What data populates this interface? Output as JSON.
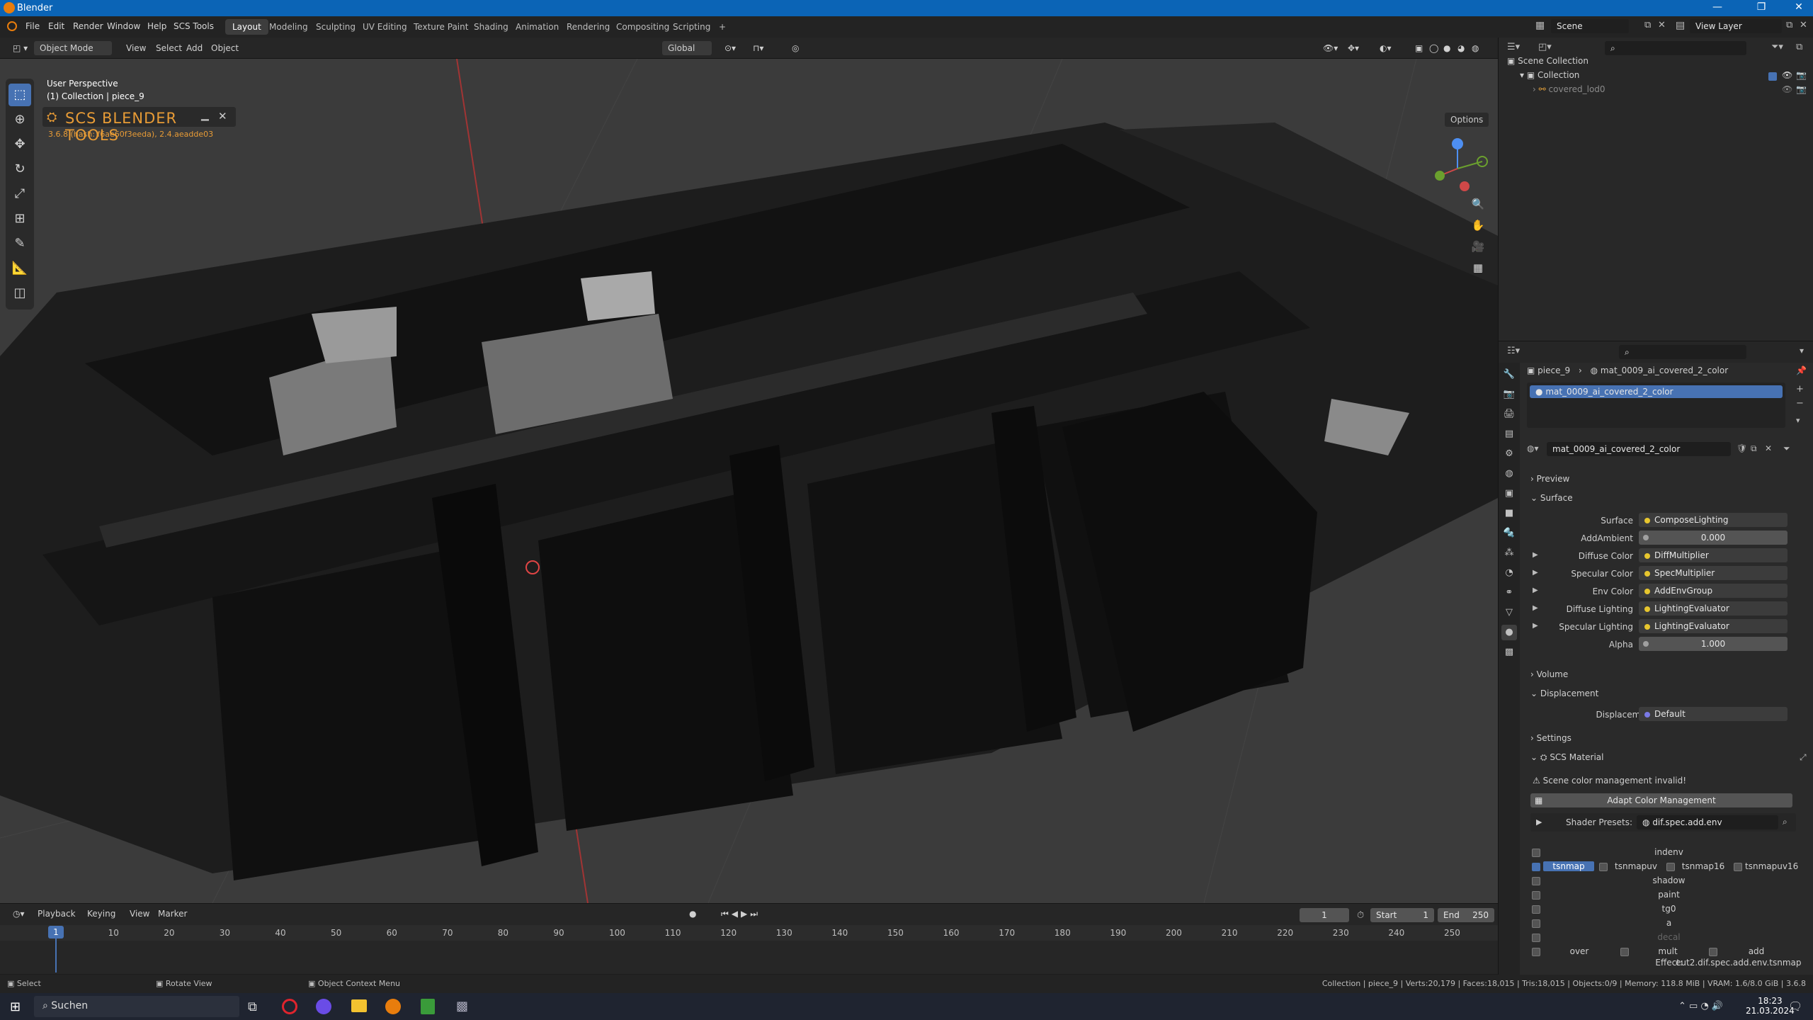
{
  "app": {
    "title": "Blender",
    "logo_color": "#e87d0d"
  },
  "menu": [
    "File",
    "Edit",
    "Render",
    "Window",
    "Help",
    "SCS Tools"
  ],
  "workspaces": [
    "Layout",
    "Modeling",
    "Sculpting",
    "UV Editing",
    "Texture Paint",
    "Shading",
    "Animation",
    "Rendering",
    "Compositing",
    "Scripting"
  ],
  "active_workspace": "Layout",
  "scene": {
    "name": "Scene",
    "view_layer": "View Layer"
  },
  "viewport": {
    "mode": "Object Mode",
    "menus": [
      "View",
      "Select",
      "Add",
      "Object"
    ],
    "transform_orientation": "Global",
    "options_label": "Options",
    "perspective_label": "User Perspective",
    "collection_label": "(1) Collection | piece_9",
    "scs_title": "SCS BLENDER TOOLS",
    "scs_version": "3.6.8 (hash: f6ae60f3eeda), 2.4.aeadde03"
  },
  "outliner": {
    "items": [
      {
        "label": "Scene Collection",
        "level": 0
      },
      {
        "label": "Collection",
        "level": 1
      },
      {
        "label": "covered_lod0",
        "level": 2
      }
    ]
  },
  "properties": {
    "breadcrumb": [
      "piece_9",
      "mat_0009_ai_covered_2_color"
    ],
    "slot": "mat_0009_ai_covered_2_color",
    "material_name": "mat_0009_ai_covered_2_color",
    "sections": {
      "preview": "Preview",
      "surface": "Surface",
      "volume": "Volume",
      "displacement": "Displacement",
      "settings": "Settings",
      "scs_material": "SCS Material"
    },
    "surface_rows": [
      {
        "label": "Surface",
        "value": "ComposeLighting",
        "kind": "socket"
      },
      {
        "label": "AddAmbient",
        "value": "0.000",
        "kind": "number"
      },
      {
        "label": "Diffuse Color",
        "value": "DiffMultiplier",
        "kind": "socket"
      },
      {
        "label": "Specular Color",
        "value": "SpecMultiplier",
        "kind": "socket"
      },
      {
        "label": "Env Color",
        "value": "AddEnvGroup",
        "kind": "socket"
      },
      {
        "label": "Diffuse Lighting",
        "value": "LightingEvaluator",
        "kind": "socket"
      },
      {
        "label": "Specular Lighting",
        "value": "LightingEvaluator",
        "kind": "socket"
      },
      {
        "label": "Alpha",
        "value": "1.000",
        "kind": "number"
      }
    ],
    "displacement_row": {
      "label": "Displacement",
      "value": "Default"
    },
    "scs": {
      "warning": "Scene color management invalid!",
      "adapt_button": "Adapt Color Management",
      "shader_presets_label": "Shader Presets:",
      "shader_preset_value": "dif.spec.add.env",
      "flags": [
        "indenv",
        "tsnmap",
        "tsnmapuv",
        "tsnmap16",
        "tsnmapuv16",
        "shadow",
        "paint",
        "tg0",
        "a",
        "decal",
        "over",
        "mult",
        "add"
      ],
      "effect_label": "Effect:",
      "effect_value": "eut2.dif.spec.add.env.tsnmap"
    }
  },
  "timeline": {
    "menus": [
      "Playback",
      "Keying",
      "View",
      "Marker"
    ],
    "current_frame": "1",
    "start_label": "Start",
    "start": "1",
    "end_label": "End",
    "end": "250",
    "ticks": [
      "10",
      "20",
      "30",
      "40",
      "50",
      "60",
      "70",
      "80",
      "90",
      "100",
      "110",
      "120",
      "130",
      "140",
      "150",
      "160",
      "170",
      "180",
      "190",
      "200",
      "210",
      "220",
      "230",
      "240",
      "250"
    ]
  },
  "statusbar": {
    "left": [
      "Select",
      "Rotate View",
      "Object Context Menu"
    ],
    "right": "Collection | piece_9 | Verts:20,179 | Faces:18,015 | Tris:18,015 | Objects:0/9 | Memory: 118.8 MiB | VRAM: 1.6/8.0 GiB | 3.6.8"
  },
  "taskbar": {
    "search": "Suchen",
    "time": "18:23",
    "date": "21.03.2024"
  }
}
